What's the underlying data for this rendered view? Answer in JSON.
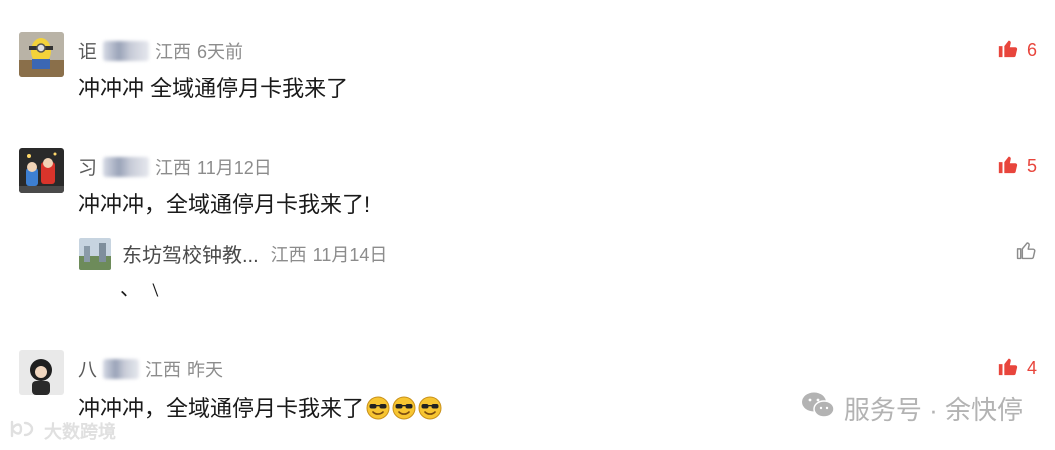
{
  "comments": [
    {
      "name": "讵",
      "location": "江西",
      "time": "6天前",
      "text": "冲冲冲    全域通停月卡我来了",
      "likes": "6"
    },
    {
      "name": "习",
      "location": "江西",
      "time": "11月12日",
      "text": "冲冲冲，全域通停月卡我来了!",
      "likes": "5",
      "reply": {
        "name": "东坊驾校钟教...",
        "location": "江西",
        "time": "11月14日",
        "text": "、  ﹨"
      }
    },
    {
      "name": "八",
      "location": "江西",
      "time": "昨天",
      "text": "冲冲冲，全域通停月卡我来了",
      "likes": "4"
    }
  ],
  "watermark": {
    "text": "服务号 · 余快停",
    "left_text": "大数跨境"
  },
  "colors": {
    "like_active": "#e8453c",
    "meta": "#8c8c8c",
    "like_inactive": "#8c8c8c"
  }
}
